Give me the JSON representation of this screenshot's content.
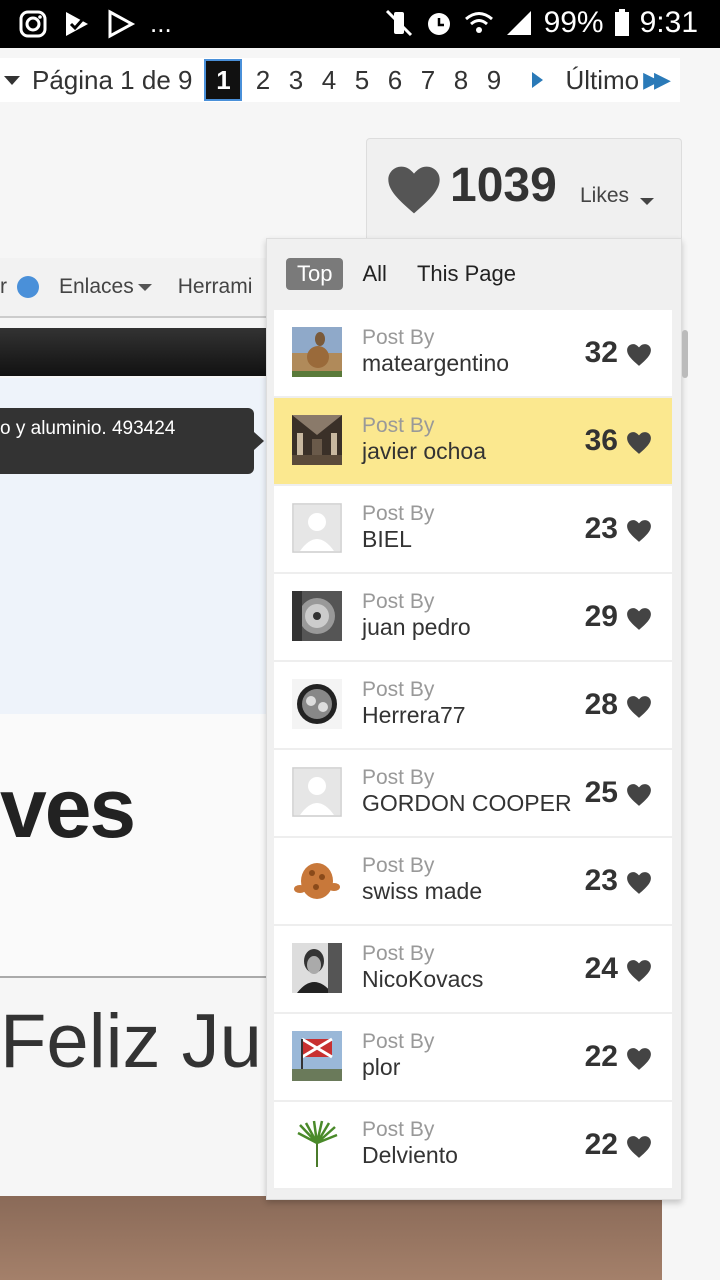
{
  "status_bar": {
    "more_icons": "...",
    "battery": "99%",
    "time": "9:31"
  },
  "pagination": {
    "label": "Página 1 de 9",
    "pages": [
      "1",
      "2",
      "3",
      "4",
      "5",
      "6",
      "7",
      "8",
      "9"
    ],
    "current": "1",
    "last_label": "Último"
  },
  "navbar": {
    "item1": "r",
    "item2": "Enlaces",
    "item3": "Herrami"
  },
  "tooltip": "o y aluminio. 493424",
  "background_text": {
    "big": "ves",
    "feliz": "Feliz Ju"
  },
  "likes": {
    "count": "1039",
    "label": "Likes"
  },
  "tabs": [
    "Top",
    "All",
    "This Page"
  ],
  "post_by_label": "Post By",
  "likers": [
    {
      "user": "mateargentino",
      "count": "32",
      "avatar": "photo-bird"
    },
    {
      "user": "javier ochoa",
      "count": "36",
      "avatar": "photo-building",
      "highlight": true
    },
    {
      "user": "BIEL",
      "count": "23",
      "avatar": "default-avatar"
    },
    {
      "user": "juan pedro",
      "count": "29",
      "avatar": "photo-watch-bw"
    },
    {
      "user": "Herrera77",
      "count": "28",
      "avatar": "photo-watch"
    },
    {
      "user": "GORDON COOPER",
      "count": "25",
      "avatar": "default-avatar"
    },
    {
      "user": "swiss made",
      "count": "23",
      "avatar": "photo-thing"
    },
    {
      "user": "NicoKovacs",
      "count": "24",
      "avatar": "photo-portrait"
    },
    {
      "user": "plor",
      "count": "22",
      "avatar": "photo-flag"
    },
    {
      "user": "Delviento",
      "count": "22",
      "avatar": "photo-palm"
    }
  ],
  "colors": {
    "highlight": "#fbe88f",
    "accent": "#2a7ab8",
    "tab_active": "#7a7a7a"
  }
}
